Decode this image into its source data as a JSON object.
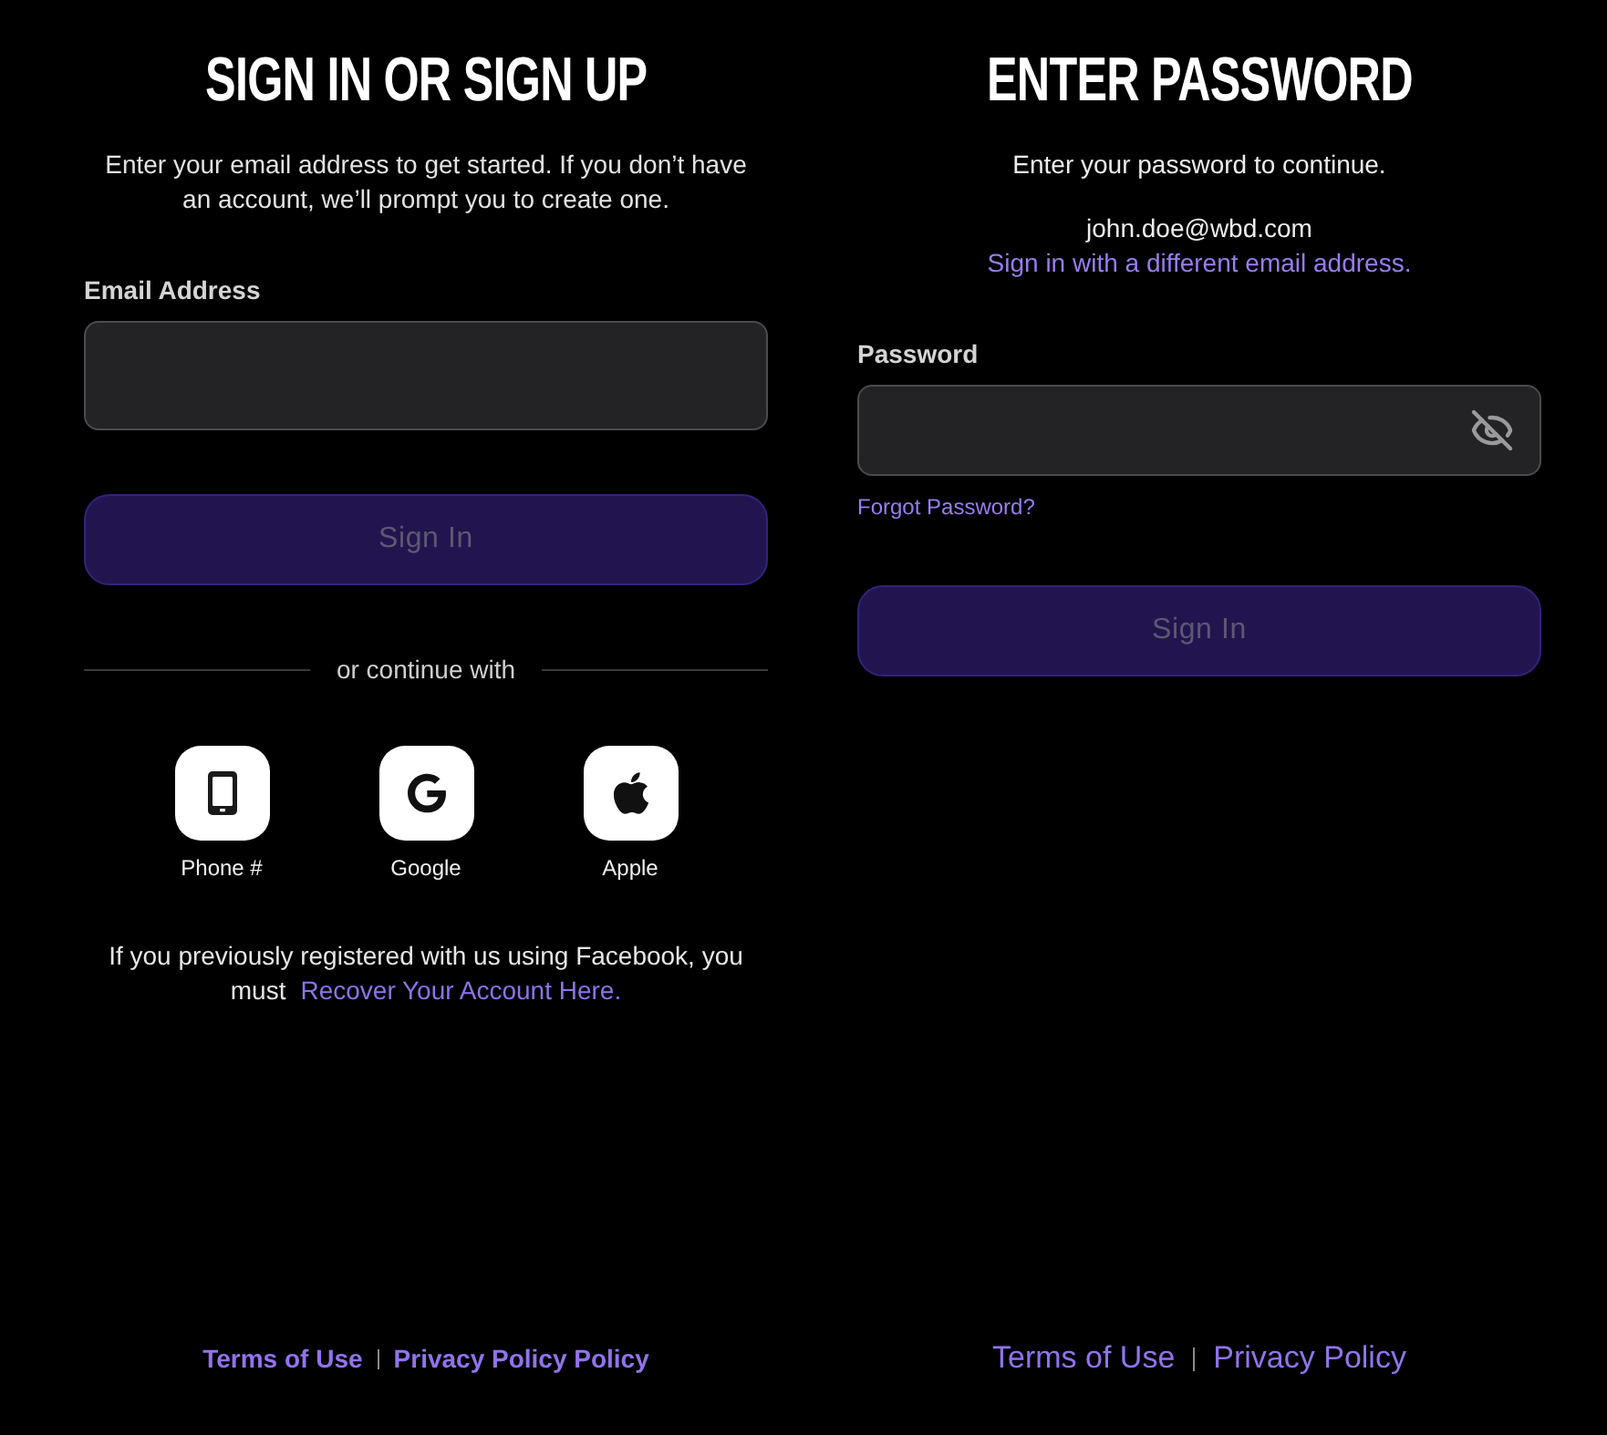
{
  "sign_in_panel": {
    "title": "SIGN IN OR SIGN UP",
    "description": "Enter your email address to get started. If you don’t have an account, we’ll prompt you to create one.",
    "email_field": {
      "label": "Email Address"
    },
    "sign_in_button": {
      "label": "Sign In",
      "disabled": true
    },
    "divider_text": "or continue with",
    "social_options": [
      {
        "kind": "phone",
        "label": "Phone #"
      },
      {
        "kind": "google",
        "label": "Google"
      },
      {
        "kind": "apple",
        "label": "Apple"
      }
    ],
    "facebook_notice": {
      "text": "If you previously registered with us using Facebook, you must",
      "link": "Recover Your Account Here."
    },
    "footer_links": [
      "Terms of Use",
      "Privacy Policy Policy"
    ]
  },
  "password_panel": {
    "title": "ENTER PASSWORD",
    "description": "Enter your password to continue.",
    "email": "john.doe@wbd.com",
    "change_email_link": "Sign in with a different email address.",
    "password_field": {
      "label": "Password",
      "show_password": false
    },
    "forgot_link": "Forgot Password?",
    "sign_in_button": {
      "label": "Sign In",
      "disabled": true
    },
    "footer_links": [
      "Terms of Use",
      "Privacy Policy"
    ]
  }
}
